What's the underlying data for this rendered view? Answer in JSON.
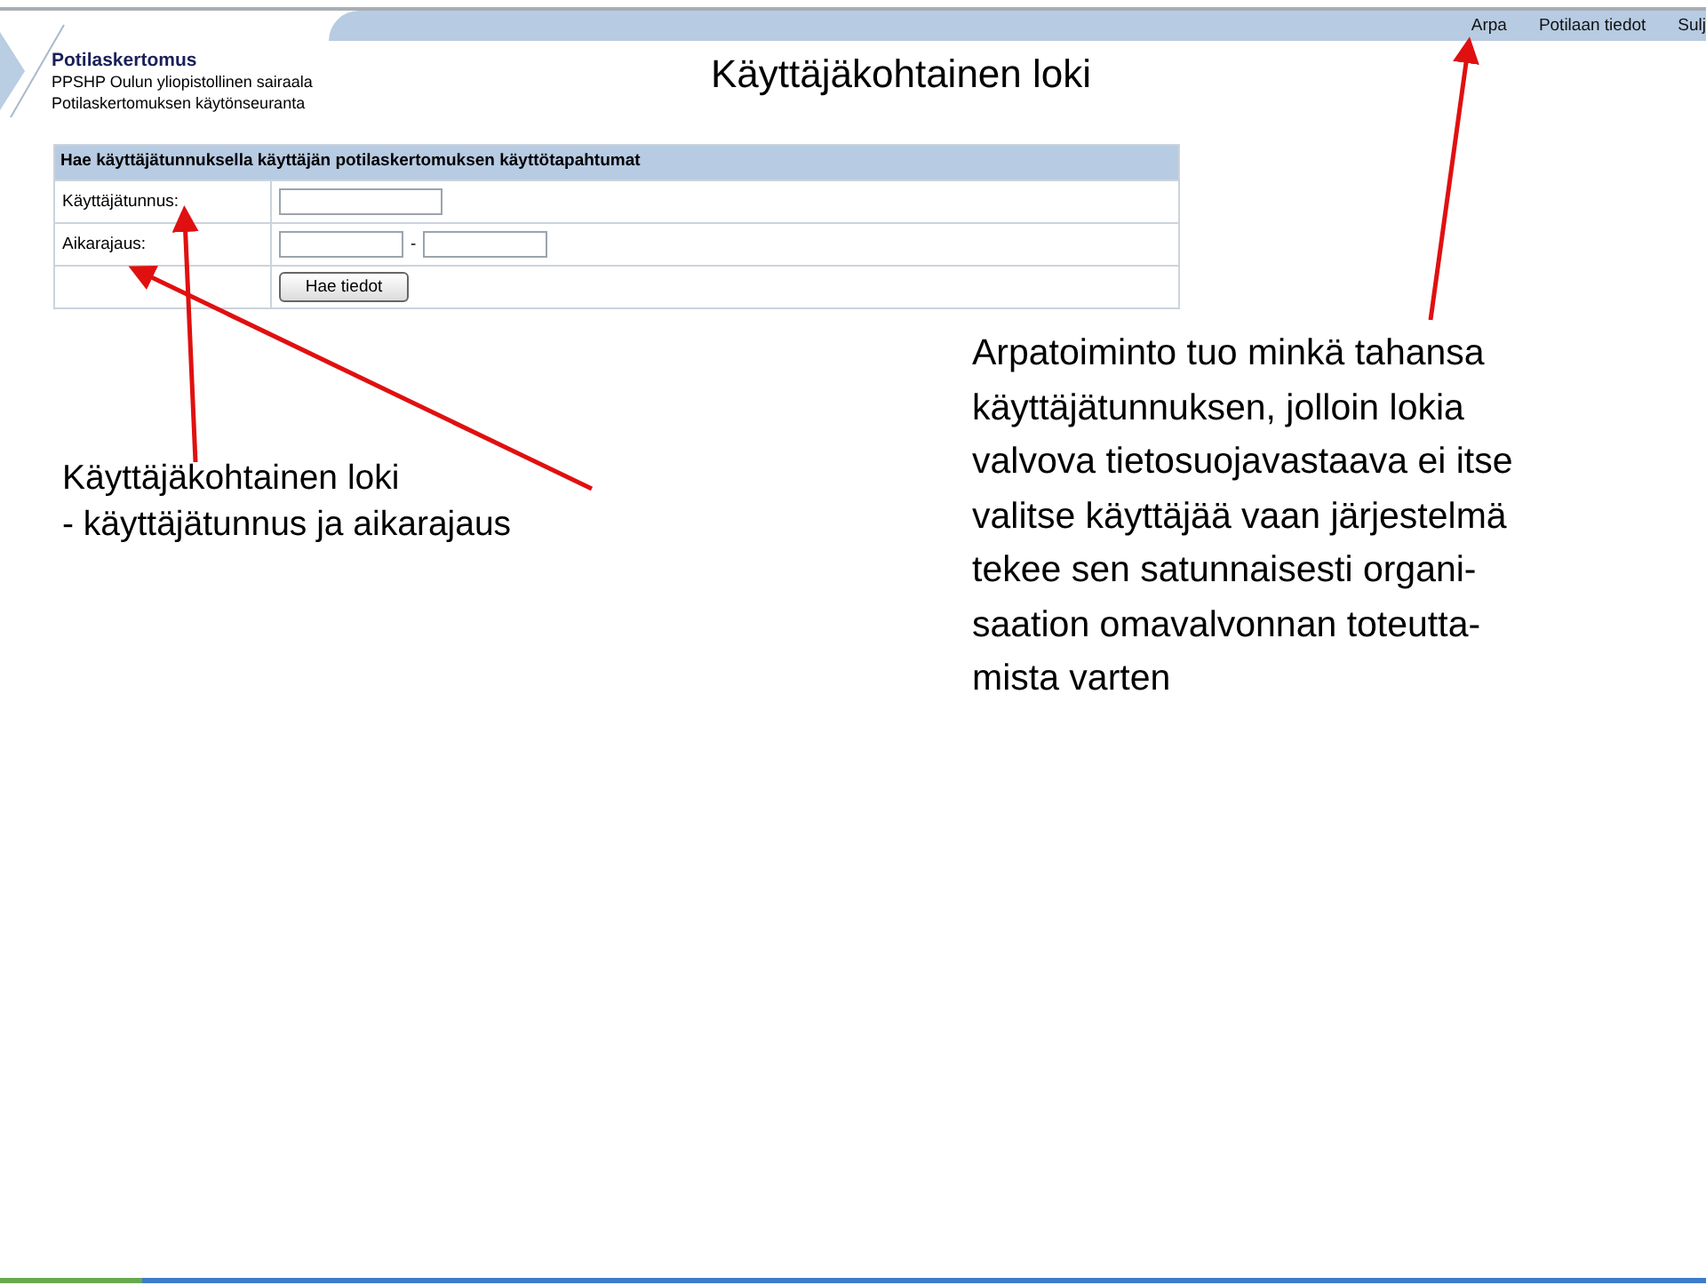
{
  "header": {
    "app_name": "Potilaskertomus",
    "organization": "PPSHP Oulun yliopistollinen sairaala",
    "subtitle": "Potilaskertomuksen käytönseuranta"
  },
  "nav_links": [
    "Arpa",
    "Potilaan tiedot",
    "Sulj"
  ],
  "page_title": "Käyttäjäkohtainen loki",
  "form": {
    "heading": "Hae käyttäjätunnuksella käyttäjän potilaskertomuksen käyttötapahtumat",
    "rows": [
      {
        "kind": "single",
        "label": "Käyttäjätunnus:"
      },
      {
        "kind": "range",
        "label": "Aikarajaus:",
        "separator": "-"
      },
      {
        "kind": "button",
        "label": "Hae tiedot"
      }
    ]
  },
  "annotations": [
    {
      "lines": [
        "Käyttäjäkohtainen loki",
        "- käyttäjätunnus ja aikarajaus"
      ]
    },
    {
      "lines": [
        "Arpatoiminto tuo minkä tahansa",
        "käyttäjätunnuksen, jolloin lokia",
        "valvova tietosuojavastaava ei itse",
        "valitse käyttäjää vaan järjestelmä",
        "tekee sen satunnaisesti organi-",
        "saation omavalvonnan toteutta-",
        "mista varten"
      ]
    }
  ]
}
